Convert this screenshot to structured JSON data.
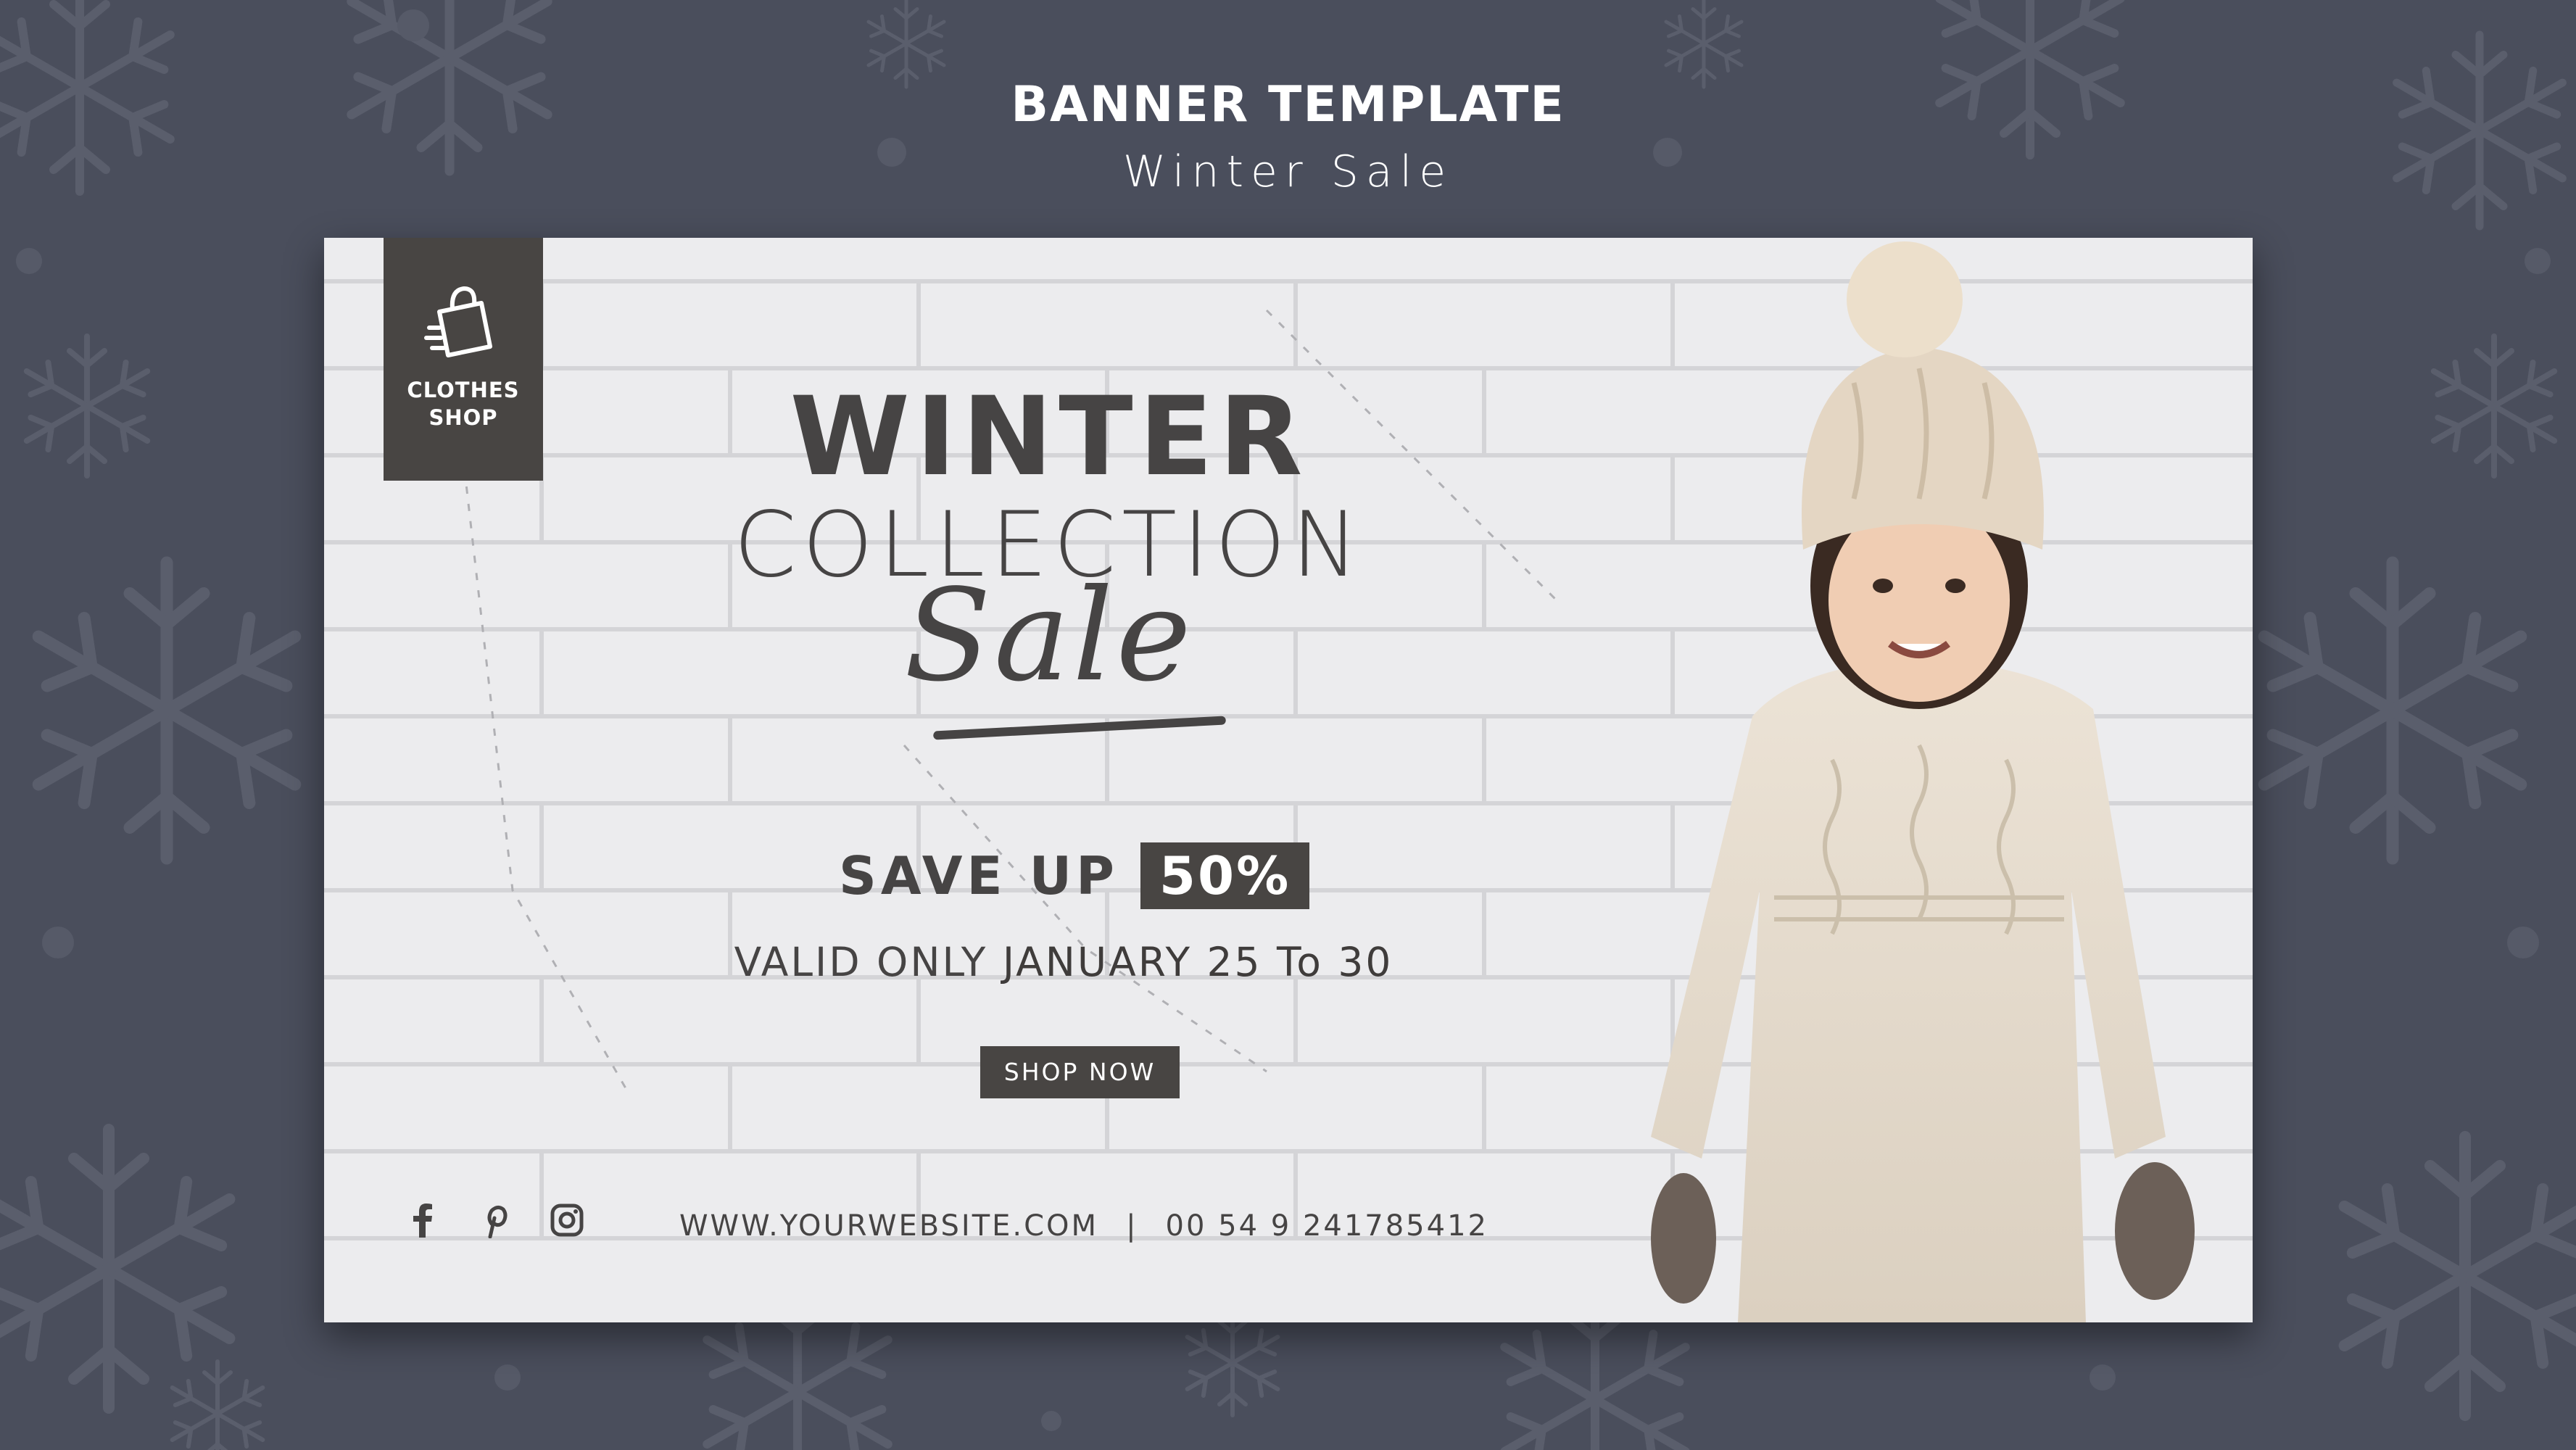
{
  "header": {
    "title": "BANNER TEMPLATE",
    "subtitle": "Winter Sale"
  },
  "logo": {
    "icon": "shopping-bag-icon",
    "line1": "CLOTHES",
    "line2": "SHOP"
  },
  "headline": {
    "line1": "WINTER",
    "line2": "COLLECTION",
    "line3": "Sale"
  },
  "offer": {
    "save_label": "SAVE UP",
    "percent": "50%",
    "valid_prefix": "VALID ONLY",
    "valid_dates": "JANUARY 25 To 30"
  },
  "cta": {
    "label": "SHOP NOW"
  },
  "footer": {
    "social_icons": [
      "facebook-icon",
      "pinterest-icon",
      "instagram-icon"
    ],
    "website": "WWW.YOURWEBSITE.COM",
    "separator": "|",
    "phone": "00 54 9 241785412"
  },
  "colors": {
    "background": "#4a4e5c",
    "banner_bg": "#ececee",
    "accent_dark": "#484543",
    "text_dark": "#464444",
    "text_light": "#ffffff"
  }
}
